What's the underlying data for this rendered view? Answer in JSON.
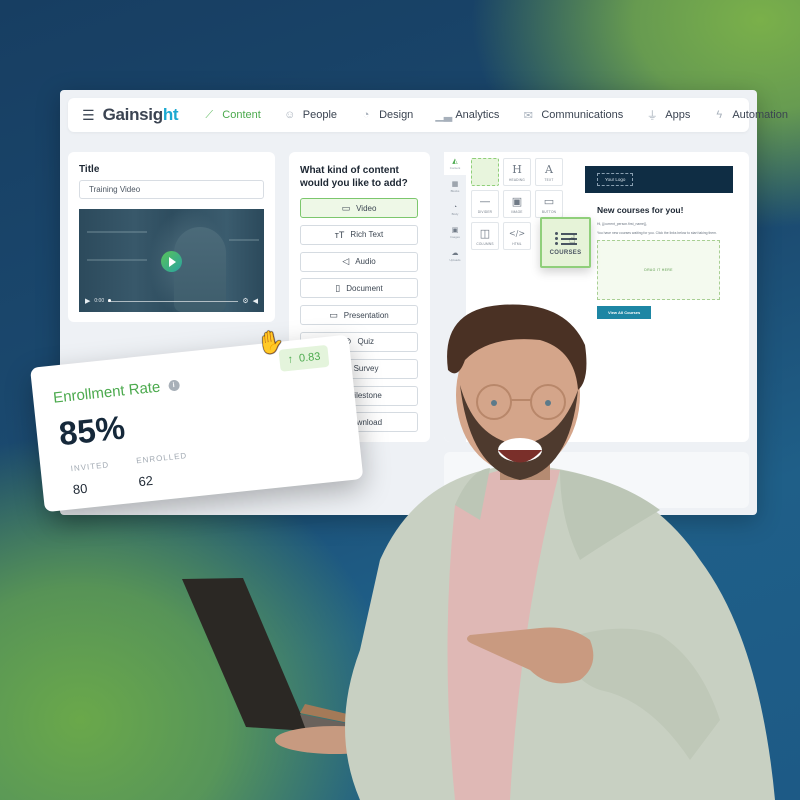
{
  "app": {
    "brand": {
      "name_main": "Gainsig",
      "name_accent": "ht",
      "accent_color": "#1ca9d1"
    },
    "nav": {
      "menu_icon": "hamburger-icon",
      "items": [
        {
          "label": "Content",
          "icon": "magic-wand-icon",
          "active": true
        },
        {
          "label": "People",
          "icon": "people-icon",
          "active": false
        },
        {
          "label": "Design",
          "icon": "palette-icon",
          "active": false
        },
        {
          "label": "Analytics",
          "icon": "chart-icon",
          "active": false
        },
        {
          "label": "Communications",
          "icon": "mail-icon",
          "active": false
        },
        {
          "label": "Apps",
          "icon": "plug-icon",
          "active": false
        },
        {
          "label": "Automation",
          "icon": "lightning-icon",
          "active": false
        }
      ]
    },
    "title_panel": {
      "label": "Title",
      "value": "Training Video",
      "video": {
        "time": "0:00"
      }
    },
    "content_panel": {
      "question": "What kind of content would you like to add?",
      "types": [
        {
          "label": "Video",
          "icon": "video-icon",
          "selected": true
        },
        {
          "label": "Rich Text",
          "icon": "text-size-icon",
          "selected": false
        },
        {
          "label": "Audio",
          "icon": "megaphone-icon",
          "selected": false
        },
        {
          "label": "Document",
          "icon": "document-icon",
          "selected": false
        },
        {
          "label": "Presentation",
          "icon": "presentation-icon",
          "selected": false
        },
        {
          "label": "Quiz",
          "icon": "check-circle-icon",
          "selected": false
        },
        {
          "label": "Survey",
          "icon": "list-icon",
          "selected": false
        },
        {
          "label": "Milestone",
          "icon": "trophy-icon",
          "selected": false
        },
        {
          "label": "Download",
          "icon": "download-icon",
          "selected": false
        }
      ]
    },
    "builder": {
      "rail": [
        {
          "label": "Content",
          "icon": "shapes-icon",
          "active": true
        },
        {
          "label": "Blocks",
          "icon": "grid-icon",
          "active": false
        },
        {
          "label": "Body",
          "icon": "palette-icon",
          "active": false
        },
        {
          "label": "Images",
          "icon": "image-icon",
          "active": false
        },
        {
          "label": "Uploads",
          "icon": "cloud-upload-icon",
          "active": false
        }
      ],
      "blocks": [
        {
          "label": "",
          "glyph": "",
          "placeholder": true
        },
        {
          "label": "HEADING",
          "glyph": "H"
        },
        {
          "label": "TEXT",
          "glyph": "A"
        },
        {
          "label": "DIVIDER",
          "glyph": "—"
        },
        {
          "label": "IMAGE",
          "glyph": "▣"
        },
        {
          "label": "BUTTON",
          "glyph": "▭"
        },
        {
          "label": "COLUMNS",
          "glyph": "◫"
        },
        {
          "label": "HTML",
          "glyph": "</>"
        }
      ],
      "dragging_block": {
        "label": "COURSES",
        "icon": "list-icon"
      },
      "email": {
        "logo_label": "Your Logo",
        "title": "New courses for you!",
        "greeting": "Hi, {{current_person.first_name}},",
        "body": "You have new courses waiting for you. Click the links below to start taking them.",
        "drop_label": "DRAG IT HERE",
        "cta_label": "View All Courses"
      }
    }
  },
  "enrollment_card": {
    "title": "Enrollment Rate",
    "rate": "85%",
    "trend": "0.83",
    "trend_direction": "up",
    "stats": [
      {
        "label": "INVITED",
        "value": "80"
      },
      {
        "label": "ENROLLED",
        "value": "62"
      }
    ],
    "accent_color": "#4caa4e"
  }
}
